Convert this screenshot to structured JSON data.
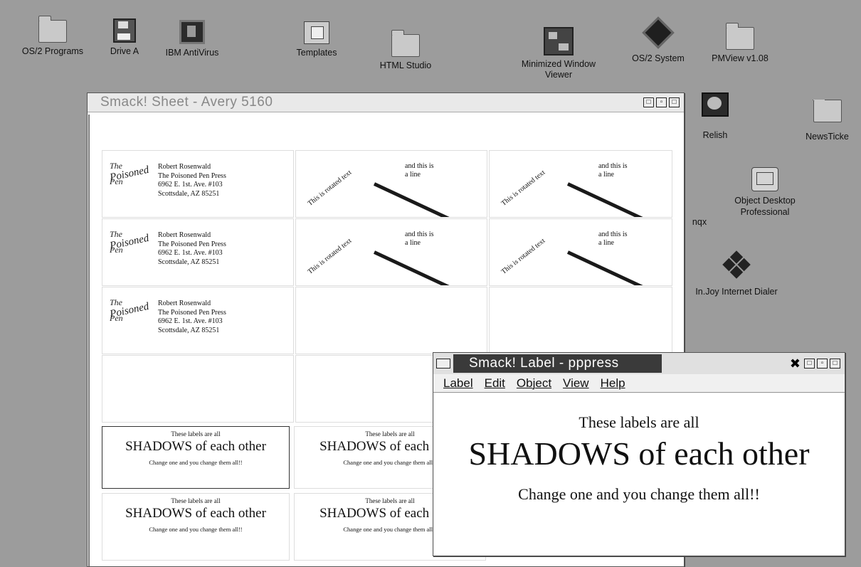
{
  "desktop": {
    "icons": [
      {
        "label": "OS/2 Programs"
      },
      {
        "label": "Drive A"
      },
      {
        "label": "IBM AntiVirus"
      },
      {
        "label": "Templates"
      },
      {
        "label": "HTML Studio"
      },
      {
        "label": "Minimized Window Viewer"
      },
      {
        "label": "OS/2 System"
      },
      {
        "label": "PMView v1.08"
      },
      {
        "label": "Relish"
      },
      {
        "label": "NewsTicke"
      },
      {
        "label": "Object Desktop Professional"
      },
      {
        "label": "In.Joy Internet Dialer"
      },
      {
        "label": "nqx"
      }
    ]
  },
  "sheet_window": {
    "title": "Smack! Sheet - Avery 5160",
    "address": {
      "line1": "Robert Rosenwald",
      "line2": "The Poisoned Pen Press",
      "line3": "6962 E. 1st. Ave. #103",
      "line4": "Scottsdale, AZ 85251"
    },
    "logo": {
      "line1": "The",
      "line2": "Poisoned",
      "line3": "Pen"
    },
    "rotated": {
      "text": "This is rotated text",
      "side_line1": "and this is",
      "side_line2": "a line"
    },
    "shadow": {
      "line1": "These labels are all",
      "line2": "SHADOWS of each other",
      "line3": "Change one and you change them all!!"
    }
  },
  "label_window": {
    "title": "Smack! Label - pppress",
    "menu": [
      "Label",
      "Edit",
      "Object",
      "View",
      "Help"
    ],
    "line1": "These labels are all",
    "line2": "SHADOWS of each other",
    "line3": "Change one and you change them all!!"
  }
}
